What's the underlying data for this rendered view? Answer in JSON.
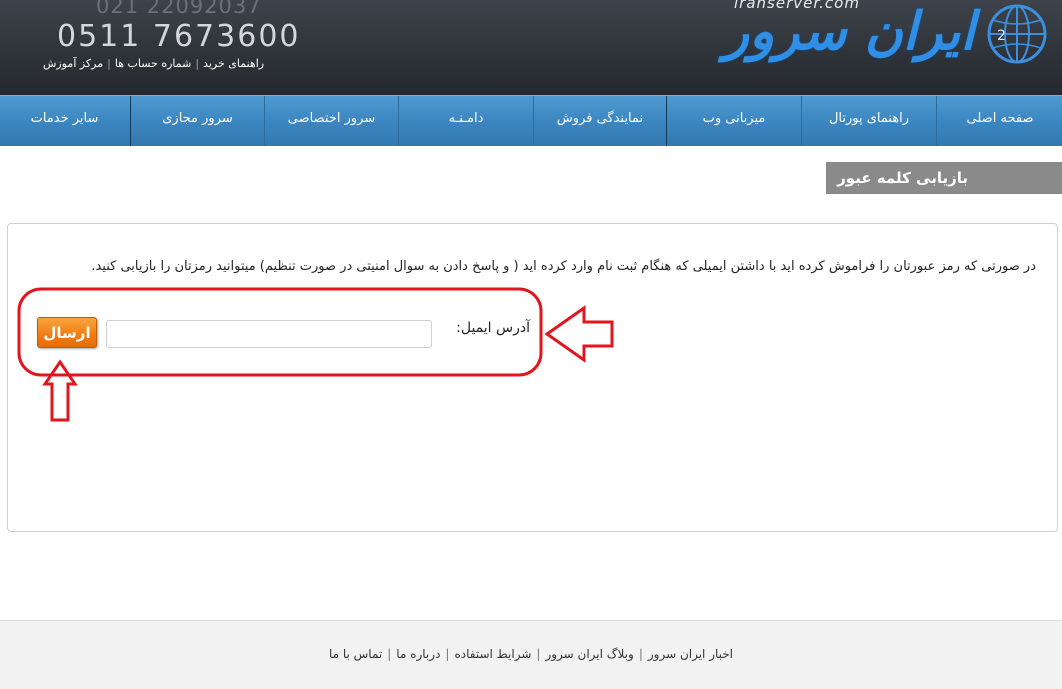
{
  "header": {
    "phone_secondary": "021 22092037",
    "phone_primary": "0511 7673600",
    "top_links": [
      "مرکز آموزش",
      "شماره حساب ها",
      "راهنمای خرید"
    ],
    "logo_latin": "iranserver.com",
    "logo_persian": "ایران سرور"
  },
  "nav": {
    "items": [
      "صفحه اصلی",
      "راهنمای پورتال",
      "میزبانی وب",
      "نمایندگی فروش",
      "دامـنـه",
      "سرور اختصاصی",
      "سرور مجازی",
      "سایر خدمات"
    ]
  },
  "page": {
    "section_title": "بازیابی کلمه عبور",
    "description": "در صورتی که رمز عبورتان را فراموش کرده اید با داشتن ایمیلی که هنگام ثبت نام وارد کرده اید ( و پاسخ دادن به سوال امنیتی در صورت تنظیم) میتوانید رمزتان را بازیابی کنید.",
    "email_label": "آدرس ایمیل:",
    "email_value": "",
    "submit_label": "ارسال"
  },
  "footer": {
    "links": [
      "اخبار ایران سرور",
      "وبلاگ ایران سرور",
      "شرایط استفاده",
      "درباره ما",
      "تماس با ما"
    ]
  },
  "colors": {
    "header_bg": "#2f343a",
    "nav_bg": "#3b85c0",
    "section_title_bg": "#8a8a8a",
    "button_orange": "#f07c12",
    "annotation_red": "#e0161e"
  }
}
